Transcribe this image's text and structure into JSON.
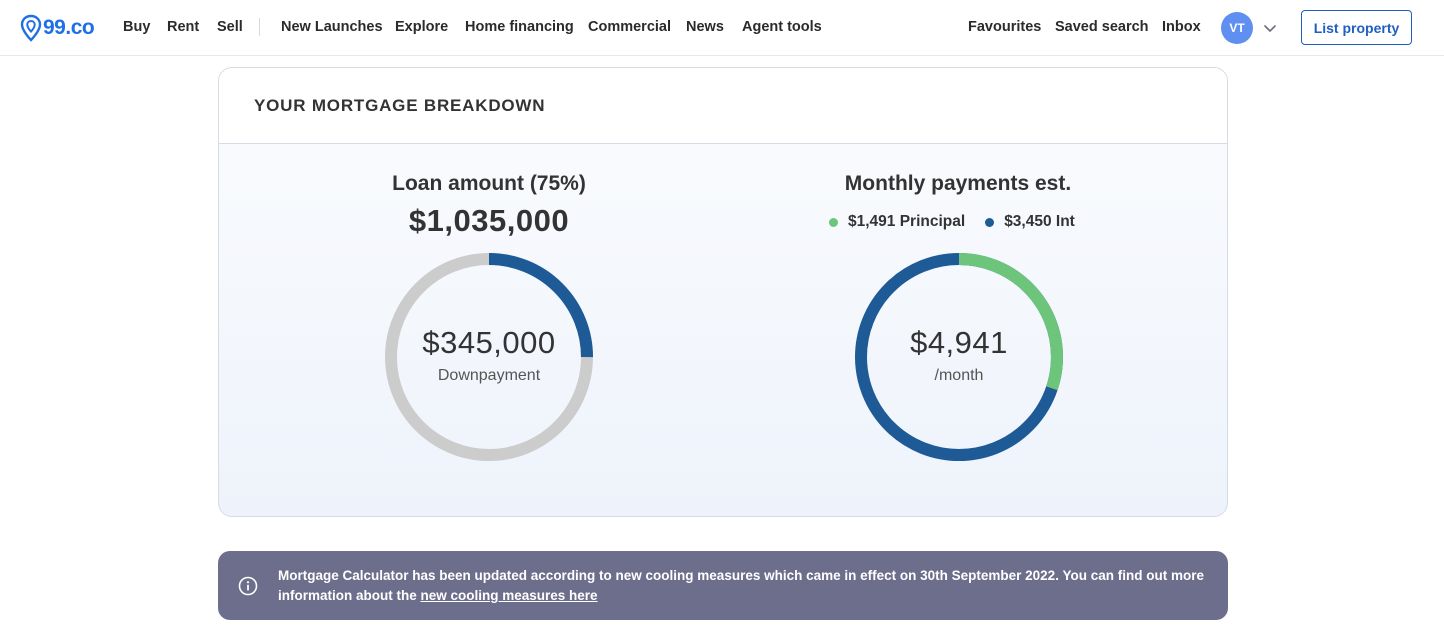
{
  "brand": {
    "logo_text": "99.co",
    "accent": "#1f6fe5"
  },
  "nav": {
    "primary": [
      "Buy",
      "Rent",
      "Sell"
    ],
    "secondary": [
      "New Launches",
      "Explore",
      "Home financing",
      "Commercial",
      "News",
      "Agent tools"
    ],
    "right": [
      "Favourites",
      "Saved search",
      "Inbox"
    ],
    "avatar_initials": "VT",
    "list_property": "List property"
  },
  "breakdown": {
    "title": "YOUR MORTGAGE BREAKDOWN",
    "loan": {
      "title": "Loan amount (75%)",
      "amount": "$1,035,000",
      "downpayment_value": "$345,000",
      "downpayment_label": "Downpayment",
      "loan_fraction": 0.25,
      "colors": {
        "arc": "#1d5a96",
        "track": "#cccccc"
      }
    },
    "monthly": {
      "title": "Monthly payments est.",
      "principal_label": "$1,491 Principal",
      "interest_label": "$3,450 Int",
      "total_value": "$4,941",
      "per_label": "/month",
      "principal": 1491,
      "interest": 3450,
      "colors": {
        "principal": "#6cc57b",
        "interest": "#1d5a96"
      }
    }
  },
  "banner": {
    "text": "Mortgage Calculator has been updated according to new cooling measures which came in effect on 30th September 2022. You can find out more information about the ",
    "link_text": "new cooling measures here",
    "icon": "info-icon"
  }
}
